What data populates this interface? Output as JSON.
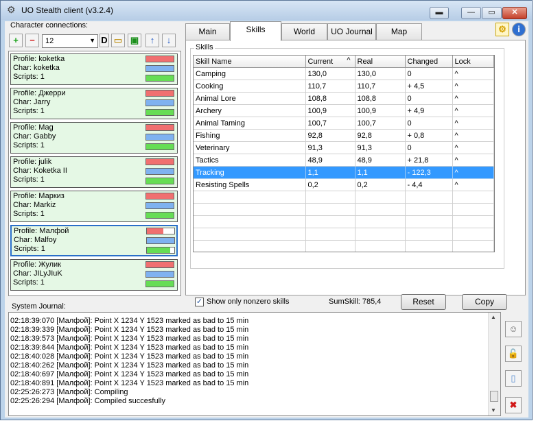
{
  "window": {
    "title": "UO Stealth client (v3.2.4)"
  },
  "connections": {
    "label": "Character connections:",
    "selected_value": "12",
    "profiles": [
      {
        "profile": "Profile: koketka",
        "char": "Char: koketka",
        "scripts": "Scripts: 1",
        "hp": 1.0,
        "mana": 1.0,
        "stam": 1.0
      },
      {
        "profile": "Profile: Джерри",
        "char": "Char: Jarry",
        "scripts": "Scripts: 1",
        "hp": 1.0,
        "mana": 1.0,
        "stam": 1.0
      },
      {
        "profile": "Profile: Mag",
        "char": "Char: Gabby",
        "scripts": "Scripts: 1",
        "hp": 1.0,
        "mana": 1.0,
        "stam": 1.0
      },
      {
        "profile": "Profile: julik",
        "char": "Char: Koketka II",
        "scripts": "Scripts: 1",
        "hp": 1.0,
        "mana": 1.0,
        "stam": 1.0
      },
      {
        "profile": "Profile: Маркиз",
        "char": "Char: Markiz",
        "scripts": "Scripts: 1",
        "hp": 1.0,
        "mana": 1.0,
        "stam": 1.0
      },
      {
        "profile": "Profile: Малфой",
        "char": "Char: Malfoy",
        "scripts": "Scripts: 1",
        "hp": 0.6,
        "mana": 1.0,
        "stam": 0.85,
        "selected": true
      },
      {
        "profile": "Profile: Жулик",
        "char": "Char: JILyJIuK",
        "scripts": "Scripts: 1",
        "hp": 1.0,
        "mana": 1.0,
        "stam": 1.0
      }
    ]
  },
  "tabs": [
    "Main",
    "Skills",
    "World",
    "UO Journal",
    "Map"
  ],
  "active_tab": "Skills",
  "skills": {
    "group_label": "Skills",
    "columns": [
      "Skill Name",
      "Current",
      "Real",
      "Changed",
      "Lock"
    ],
    "sort_glyph": "^",
    "rows": [
      [
        "Camping",
        "130,0",
        "130,0",
        "0",
        "^"
      ],
      [
        "Cooking",
        "110,7",
        "110,7",
        "+ 4,5",
        "^"
      ],
      [
        "Animal Lore",
        "108,8",
        "108,8",
        "0",
        "^"
      ],
      [
        "Archery",
        "100,9",
        "100,9",
        "+ 4,9",
        "^"
      ],
      [
        "Animal Taming",
        "100,7",
        "100,7",
        "0",
        "^"
      ],
      [
        "Fishing",
        "92,8",
        "92,8",
        "+ 0,8",
        "^"
      ],
      [
        "Veterinary",
        "91,3",
        "91,3",
        "0",
        "^"
      ],
      [
        "Tactics",
        "48,9",
        "48,9",
        "+ 21,8",
        "^"
      ],
      [
        "Tracking",
        "1,1",
        "1,1",
        "- 122,3",
        "^"
      ],
      [
        "Resisting Spells",
        "0,2",
        "0,2",
        "- 4,4",
        "^"
      ]
    ],
    "selected_row": 8,
    "checkbox_label": "Show only nonzero skills",
    "checkbox_checked": true,
    "sumskill": "SumSkill: 785,4",
    "reset_label": "Reset",
    "copy_label": "Copy"
  },
  "journal": {
    "label": "System Journal:",
    "lines": [
      "02:18:39:070 [Малфой]: Point X 1234 Y 1523 marked as bad to 15 min",
      "02:18:39:339 [Малфой]: Point X 1234 Y 1523 marked as bad to 15 min",
      "02:18:39:573 [Малфой]: Point X 1234 Y 1523 marked as bad to 15 min",
      "02:18:39:844 [Малфой]: Point X 1234 Y 1523 marked as bad to 15 min",
      "02:18:40:028 [Малфой]: Point X 1234 Y 1523 marked as bad to 15 min",
      "02:18:40:262 [Малфой]: Point X 1234 Y 1523 marked as bad to 15 min",
      "02:18:40:697 [Малфой]: Point X 1234 Y 1523 marked as bad to 15 min",
      "02:18:40:891 [Малфой]: Point X 1234 Y 1523 marked as bad to 15 min",
      "02:25:26:273 [Малфой]: Compiling",
      "02:25:26:294 [Малфой]: Compiled succesfully"
    ]
  },
  "colors": {
    "hp": "#f07070",
    "mana": "#7fb2f0",
    "stam": "#66dd55",
    "selection": "#3399ff",
    "card": "#e5f8e5"
  }
}
